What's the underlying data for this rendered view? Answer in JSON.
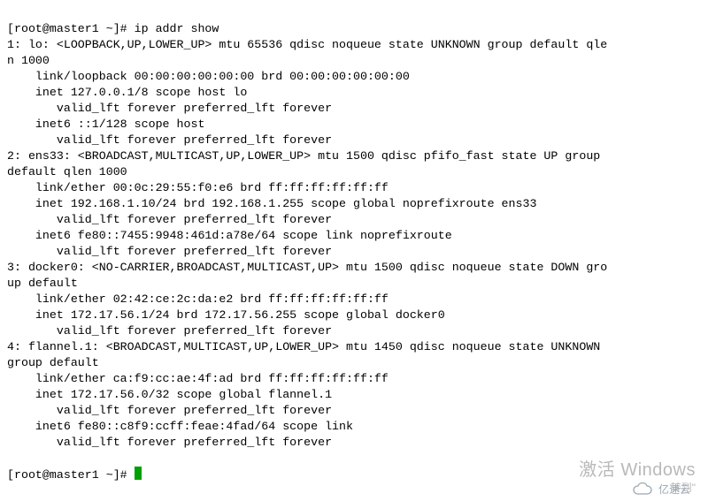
{
  "prompt": {
    "user": "root",
    "host": "master1",
    "dir": "~",
    "symbol": "#",
    "prefix": "[root@master1 ~]#"
  },
  "command": "ip addr show",
  "output": {
    "lines": [
      "1: lo: <LOOPBACK,UP,LOWER_UP> mtu 65536 qdisc noqueue state UNKNOWN group default qle",
      "n 1000",
      "    link/loopback 00:00:00:00:00:00 brd 00:00:00:00:00:00",
      "    inet 127.0.0.1/8 scope host lo",
      "       valid_lft forever preferred_lft forever",
      "    inet6 ::1/128 scope host ",
      "       valid_lft forever preferred_lft forever",
      "2: ens33: <BROADCAST,MULTICAST,UP,LOWER_UP> mtu 1500 qdisc pfifo_fast state UP group ",
      "default qlen 1000",
      "    link/ether 00:0c:29:55:f0:e6 brd ff:ff:ff:ff:ff:ff",
      "    inet 192.168.1.10/24 brd 192.168.1.255 scope global noprefixroute ens33",
      "       valid_lft forever preferred_lft forever",
      "    inet6 fe80::7455:9948:461d:a78e/64 scope link noprefixroute ",
      "       valid_lft forever preferred_lft forever",
      "3: docker0: <NO-CARRIER,BROADCAST,MULTICAST,UP> mtu 1500 qdisc noqueue state DOWN gro",
      "up default ",
      "    link/ether 02:42:ce:2c:da:e2 brd ff:ff:ff:ff:ff:ff",
      "    inet 172.17.56.1/24 brd 172.17.56.255 scope global docker0",
      "       valid_lft forever preferred_lft forever",
      "4: flannel.1: <BROADCAST,MULTICAST,UP,LOWER_UP> mtu 1450 qdisc noqueue state UNKNOWN ",
      "group default ",
      "    link/ether ca:f9:cc:ae:4f:ad brd ff:ff:ff:ff:ff:ff",
      "    inet 172.17.56.0/32 scope global flannel.1",
      "       valid_lft forever preferred_lft forever",
      "    inet6 fe80::c8f9:ccff:feae:4fad/64 scope link ",
      "       valid_lft forever preferred_lft forever"
    ]
  },
  "watermark": {
    "line1": "激活 Windows",
    "line2_prefix": "转到\"",
    "logo_text": "亿速云"
  }
}
